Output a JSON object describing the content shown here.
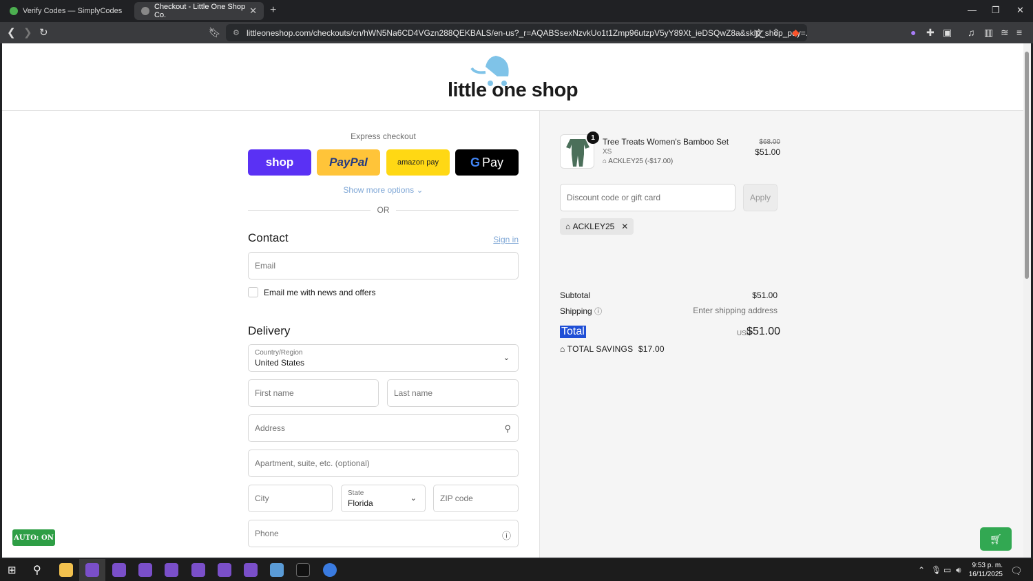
{
  "browser": {
    "tabs": [
      {
        "title": "Verify Codes — SimplyCodes",
        "active": false
      },
      {
        "title": "Checkout - Little One Shop Co.",
        "active": true
      }
    ],
    "url": "littleoneshop.com/checkouts/cn/hWN5Na6CD4VGzn288QEKBALS/en-us?_r=AQABSsexNzvkUo1t1Zmp96utzpV5yY89Xt_ieDSQwZ8a&skip_shop_pay=..."
  },
  "store": {
    "logo_text": "little one shop"
  },
  "express": {
    "title": "Express checkout",
    "buttons": {
      "shop": "shop",
      "paypal": "PayPal",
      "amazon": "amazon pay",
      "gpay": "Pay"
    },
    "show_more": "Show more options",
    "or": "OR"
  },
  "contact": {
    "heading": "Contact",
    "sign_in": "Sign in",
    "email_placeholder": "Email",
    "news_label": "Email me with news and offers"
  },
  "delivery": {
    "heading": "Delivery",
    "country_label": "Country/Region",
    "country_value": "United States",
    "first_name": "First name",
    "last_name": "Last name",
    "address": "Address",
    "apartment": "Apartment, suite, etc. (optional)",
    "city": "City",
    "state_label": "State",
    "state_value": "Florida",
    "zip": "ZIP code",
    "phone": "Phone"
  },
  "order": {
    "quantity": "1",
    "product_name": "Tree Treats Women's Bamboo Set",
    "variant": "XS",
    "discount_line": "ACKLEY25 (-$17.00)",
    "old_price": "$68.00",
    "new_price": "$51.00",
    "discount_placeholder": "Discount code or gift card",
    "apply": "Apply",
    "applied_code": "ACKLEY25",
    "subtotal_label": "Subtotal",
    "subtotal_value": "$51.00",
    "shipping_label": "Shipping",
    "shipping_value": "Enter shipping address",
    "total_label": "Total",
    "currency": "USD",
    "total_value": "$51.00",
    "savings_label": "TOTAL SAVINGS",
    "savings_value": "$17.00"
  },
  "extension": {
    "auto_label": "AUTO: ON"
  },
  "taskbar": {
    "time": "9:53 p. m.",
    "date": "16/11/2025"
  }
}
